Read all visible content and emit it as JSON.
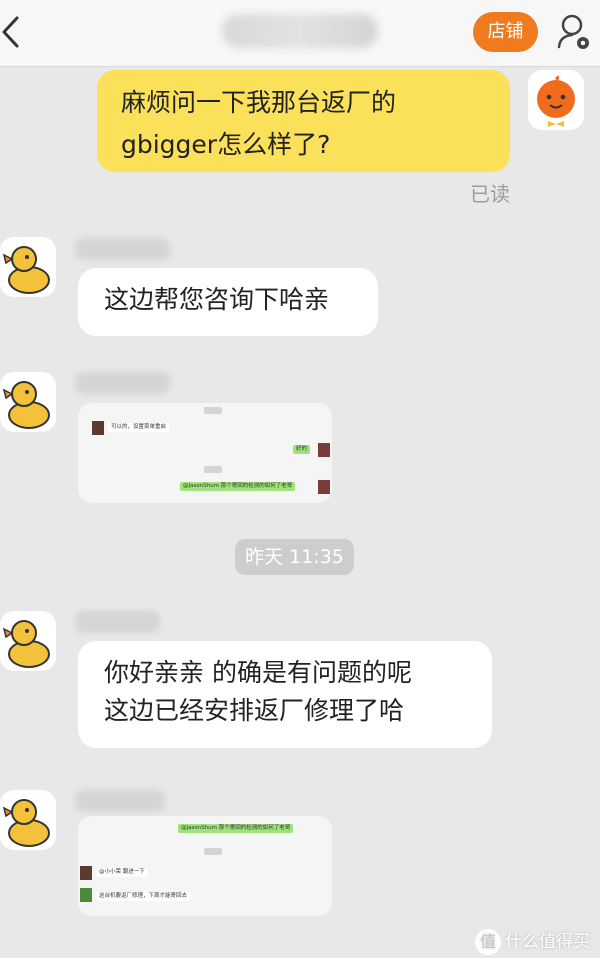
{
  "header": {
    "shop_label": "店铺"
  },
  "chat": {
    "msg_user": "麻烦问一下我那台返厂的gbigger怎么样了?",
    "read_status": "已读",
    "msg_reply1": "这边帮您咨询下哈亲",
    "shot1": {
      "line1": "可以的，设置菜单重启",
      "line2": "好的",
      "line3": "@JasonShum 那个寄回的检测的如何了老哥"
    },
    "timestamp": "昨天 11:35",
    "msg_reply2_line1": "你好亲亲 的确是有问题的呢",
    "msg_reply2_line2": "这边已经安排返厂修理了哈",
    "shot2": {
      "line1": "@JasonShum 那个寄回的检测的如何了老哥",
      "line2": "@小小荣 跟进一下",
      "line3": "这台机要返厂修理，下周才能寄回去"
    }
  },
  "watermark": {
    "icon_glyph": "值",
    "text": "什么值得买"
  },
  "colors": {
    "accent": "#f07b1e",
    "user_bubble": "#fbe15a",
    "background": "#e8e8e8"
  }
}
